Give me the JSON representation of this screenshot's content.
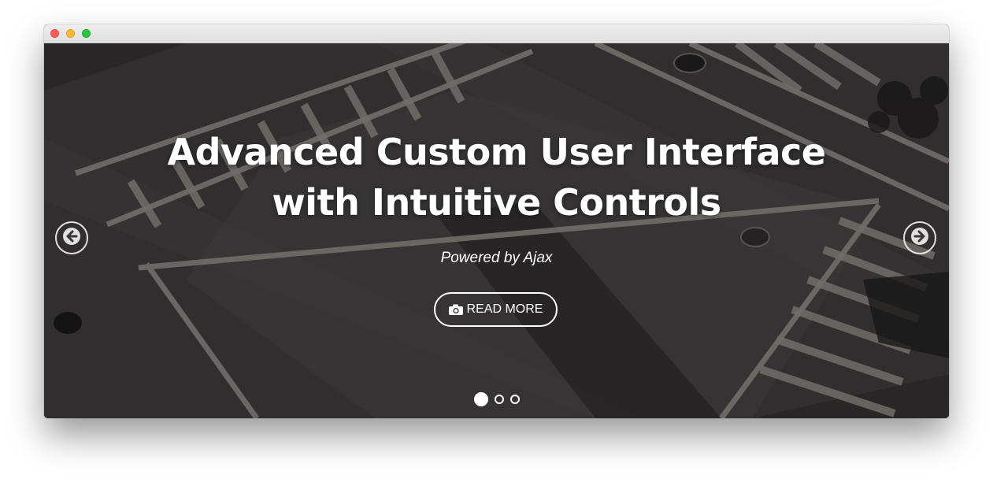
{
  "window": {
    "controls": [
      "close",
      "minimize",
      "maximize"
    ]
  },
  "slider": {
    "headline": "Advanced Custom User Interface with Intuitive Controls",
    "subtitle": "Powered by Ajax",
    "button": {
      "label": "READ MORE",
      "icon": "camera-icon"
    },
    "prev_icon": "arrow-left-icon",
    "next_icon": "arrow-right-icon",
    "slides_total": 3,
    "active_slide": 1
  },
  "colors": {
    "overlay_text": "#ffffff",
    "background_dark": "#2c2a2a",
    "close": "#fc5f57",
    "minimize": "#fdbc2f",
    "maximize": "#29c73f"
  }
}
